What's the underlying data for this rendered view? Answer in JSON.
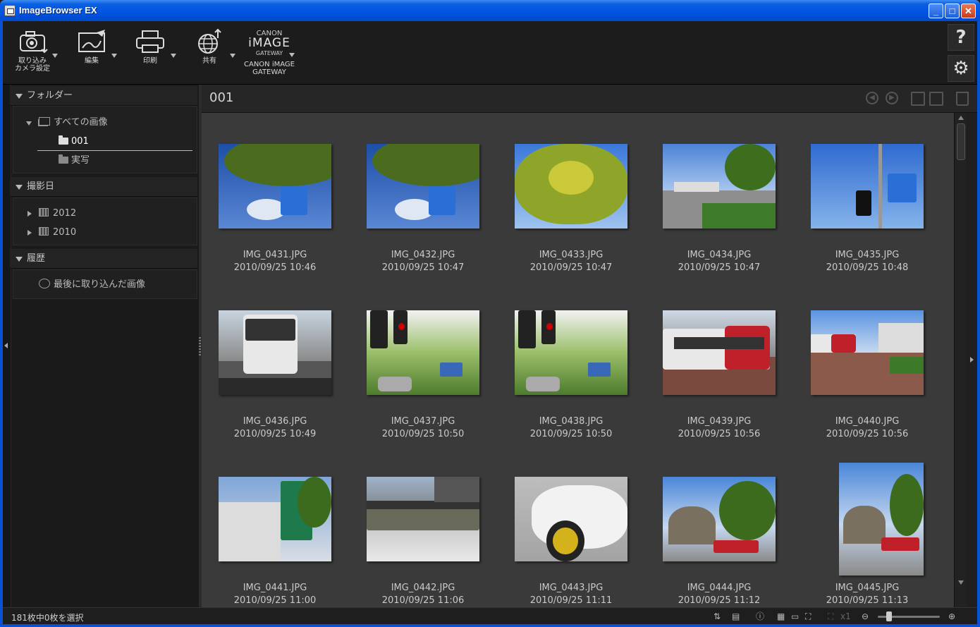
{
  "window": {
    "title": "ImageBrowser EX",
    "minimize": "_",
    "maximize": "□",
    "close": "✕"
  },
  "toolbar": {
    "import_label": "取り込み\nカメラ設定",
    "edit_label": "編集",
    "print_label": "印刷",
    "share_label": "共有",
    "cig_logo_top": "CANON",
    "cig_logo_mid": "iMAGE",
    "cig_logo_bot": "GATEWAY",
    "cig_label": "CANON iMAGE\nGATEWAY",
    "help_label": "?",
    "settings_label": "⚙"
  },
  "sidebar": {
    "folder_header": "フォルダー",
    "all_images": "すべての画像",
    "folder_001": "001",
    "folder_jissha": "実写",
    "date_header": "撮影日",
    "year_2012": "2012",
    "year_2010": "2010",
    "history_header": "履歴",
    "last_imported": "最後に取り込んだ画像"
  },
  "content": {
    "folder_title": "001",
    "thumbnails": [
      {
        "name": "IMG_0431.JPG",
        "date": "2010/09/25 10:46",
        "scene": "tree-sign"
      },
      {
        "name": "IMG_0432.JPG",
        "date": "2010/09/25 10:47",
        "scene": "tree-sign"
      },
      {
        "name": "IMG_0433.JPG",
        "date": "2010/09/25 10:47",
        "scene": "tree"
      },
      {
        "name": "IMG_0434.JPG",
        "date": "2010/09/25 10:47",
        "scene": "street"
      },
      {
        "name": "IMG_0435.JPG",
        "date": "2010/09/25 10:48",
        "scene": "signal-sign"
      },
      {
        "name": "IMG_0436.JPG",
        "date": "2010/09/25 10:49",
        "scene": "bus"
      },
      {
        "name": "IMG_0437.JPG",
        "date": "2010/09/25 10:50",
        "scene": "traffic-light"
      },
      {
        "name": "IMG_0438.JPG",
        "date": "2010/09/25 10:50",
        "scene": "traffic-light"
      },
      {
        "name": "IMG_0439.JPG",
        "date": "2010/09/25 10:56",
        "scene": "tram"
      },
      {
        "name": "IMG_0440.JPG",
        "date": "2010/09/25 10:56",
        "scene": "tram-far"
      },
      {
        "name": "IMG_0441.JPG",
        "date": "2010/09/25 11:00",
        "scene": "green-sign"
      },
      {
        "name": "IMG_0442.JPG",
        "date": "2010/09/25 11:06",
        "scene": "tram-side"
      },
      {
        "name": "IMG_0443.JPG",
        "date": "2010/09/25 11:11",
        "scene": "car"
      },
      {
        "name": "IMG_0444.JPG",
        "date": "2010/09/25 11:12",
        "scene": "dome"
      },
      {
        "name": "IMG_0445.JPG",
        "date": "2010/09/25 11:13",
        "scene": "dome-portrait"
      }
    ]
  },
  "statusbar": {
    "selection_count": "181枚中0枚を選択",
    "zoom_text": "x1"
  },
  "colors": {
    "titlebar": "#0054e3",
    "app_bg": "#1b1b1b",
    "grid_bg": "#3a3a3a"
  }
}
